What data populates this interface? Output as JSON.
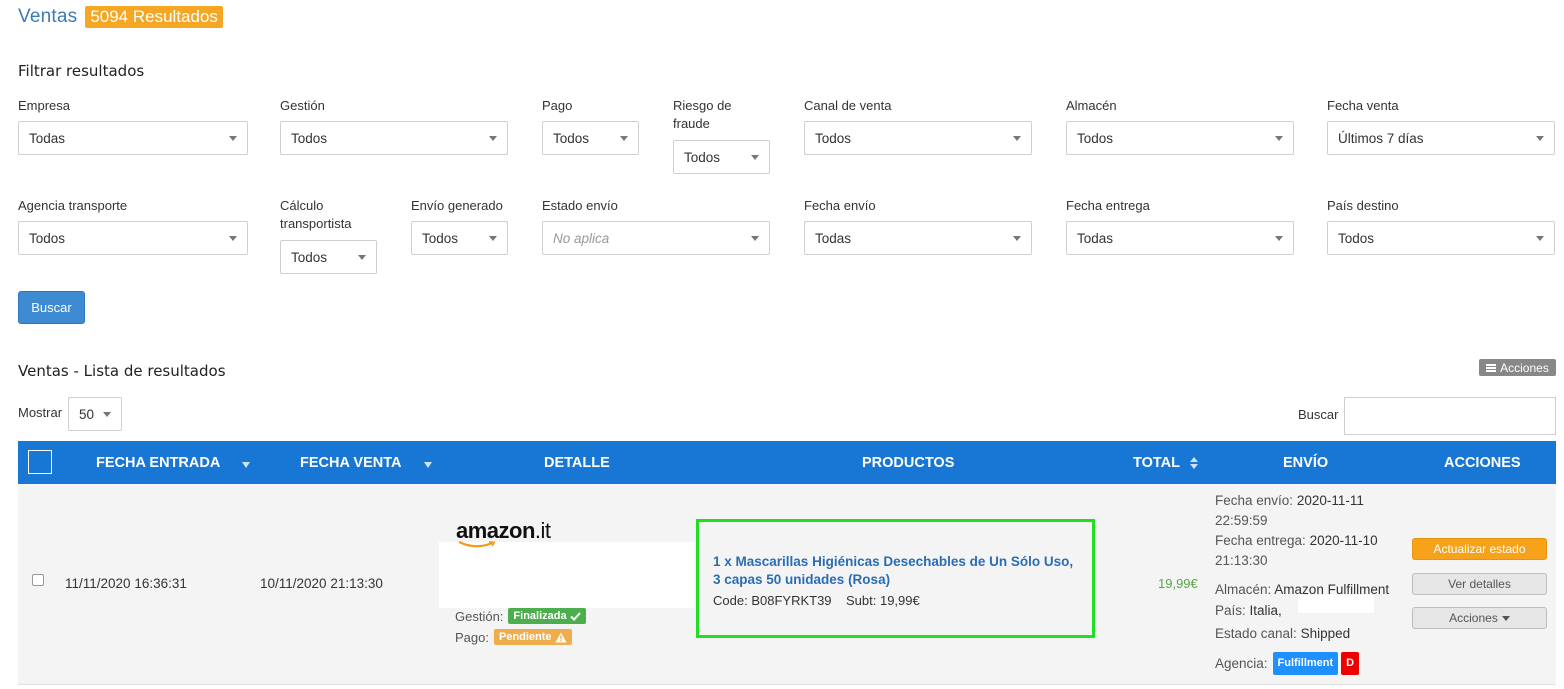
{
  "header": {
    "title": "Ventas",
    "results_badge": "5094 Resultados"
  },
  "filters": {
    "title": "Filtrar resultados",
    "row1": [
      {
        "label": "Empresa",
        "value": "Todas"
      },
      {
        "label": "Gestión",
        "value": "Todos"
      },
      {
        "label": "Pago",
        "value": "Todos"
      },
      {
        "label": "Riesgo de fraude",
        "label_line1": "Riesgo de",
        "label_line2": "fraude",
        "value": "Todos"
      },
      {
        "label": "Canal de venta",
        "value": "Todos"
      },
      {
        "label": "Almacén",
        "value": "Todos"
      },
      {
        "label": "Fecha venta",
        "value": "Últimos 7 días"
      }
    ],
    "row2": [
      {
        "label": "Agencia transporte",
        "value": "Todos"
      },
      {
        "label": "Cálculo transportista",
        "label_line1": "Cálculo",
        "label_line2": "transportista",
        "value": "Todos"
      },
      {
        "label": "Envío generado",
        "value": "Todos"
      },
      {
        "label": "Estado envío",
        "placeholder": "No aplica"
      },
      {
        "label": "Fecha envío",
        "value": "Todas"
      },
      {
        "label": "Fecha entrega",
        "value": "Todas"
      },
      {
        "label": "País destino",
        "value": "Todos"
      }
    ],
    "search_button": "Buscar"
  },
  "list": {
    "title": "Ventas - Lista de resultados",
    "actions_button": "Acciones",
    "show_label": "Mostrar",
    "page_size": "50",
    "search_label": "Buscar",
    "columns": [
      "FECHA ENTRADA",
      "FECHA VENTA",
      "DETALLE",
      "PRODUCTOS",
      "TOTAL",
      "ENVÍO",
      "ACCIONES"
    ],
    "rows": [
      {
        "fecha_entrada": "11/11/2020 16:36:31",
        "fecha_venta": "10/11/2020 21:13:30",
        "detalle": {
          "logo_main": "amazon",
          "logo_suffix": ".it",
          "gestion_label": "Gestión:",
          "gestion_badge": "Finalizada",
          "pago_label": "Pago:",
          "pago_badge": "Pendiente"
        },
        "producto": {
          "name": "1 x Mascarillas Higiénicas Desechables de Un Sólo Uso, 3 capas 50 unidades (Rosa)",
          "code_label": "Code:",
          "code": "B08FYRKT39",
          "subt_label": "Subt:",
          "subt": "19,99€"
        },
        "total": "19,99€",
        "envio": {
          "fecha_envio_label": "Fecha envío:",
          "fecha_envio_date": "2020-11-11",
          "fecha_envio_time": "22:59:59",
          "fecha_entrega_label": "Fecha entrega:",
          "fecha_entrega_date": "2020-11-10",
          "fecha_entrega_time": "21:13:30",
          "almacen_label": "Almacén:",
          "almacen": "Amazon Fulfillment",
          "pais_label": "País:",
          "pais": "Italia,",
          "estado_label": "Estado canal:",
          "estado": "Shipped",
          "agencia_label": "Agencia:",
          "agencia_badge": "Fulfillment",
          "agencia_flag": "D"
        },
        "acciones": {
          "actualizar": "Actualizar estado",
          "ver_detalles": "Ver detalles",
          "acciones": "Acciones"
        }
      }
    ]
  },
  "colors": {
    "header_blue": "#1877d4",
    "badge_orange": "#f5a623",
    "highlight_green": "#22dd22"
  }
}
